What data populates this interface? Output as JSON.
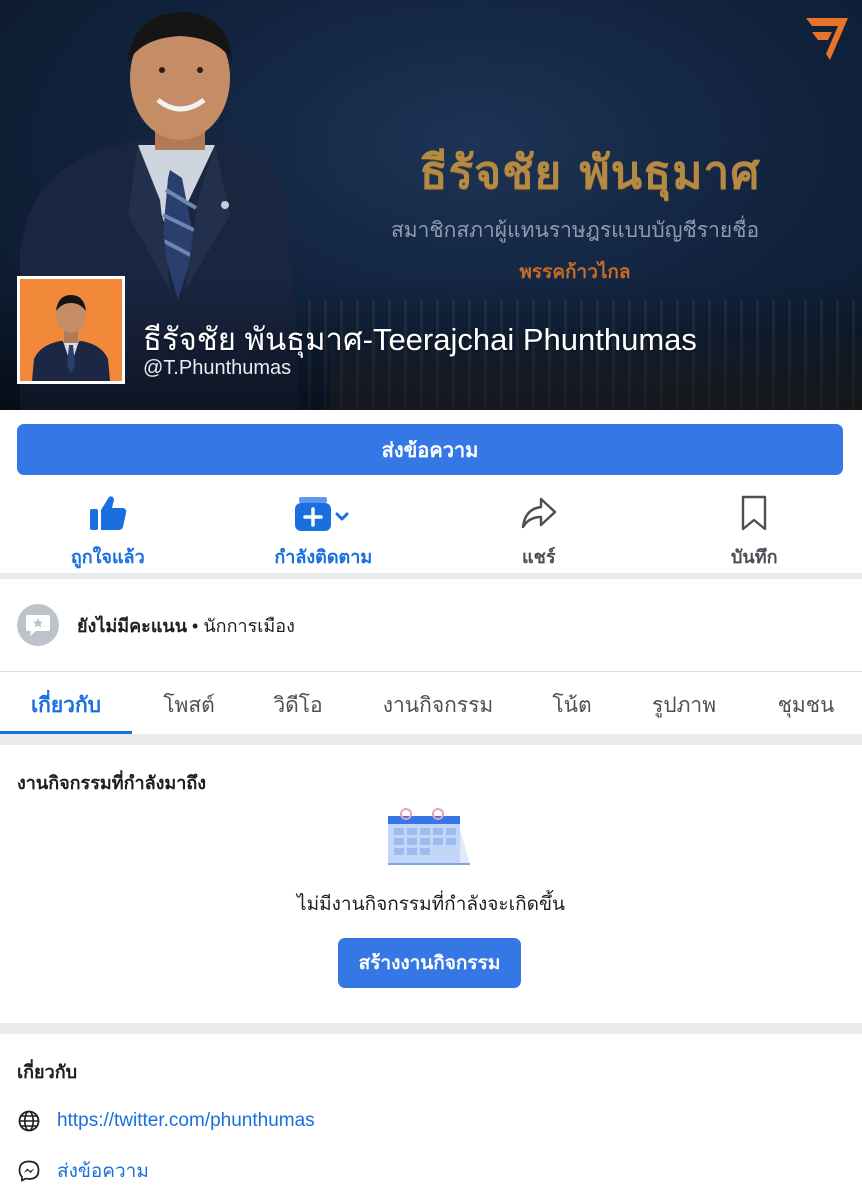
{
  "cover": {
    "name_th": "ธีรัจชัย พันธุมาศ",
    "role": "สมาชิกสภาผู้แทนราษฎรแบบบัญชีรายชื่อ",
    "party": "พรรคก้าวไกล"
  },
  "profile": {
    "name": "ธีรัจชัย พันธุมาศ-Teerajchai Phunthumas",
    "handle": "@T.Phunthumas"
  },
  "message_button": "ส่งข้อความ",
  "actions": [
    {
      "label": "ถูกใจแล้ว",
      "icon": "thumbs-up-icon",
      "active": true
    },
    {
      "label": "กำลังติดตาม",
      "icon": "following-icon",
      "active": true
    },
    {
      "label": "แชร์",
      "icon": "share-icon",
      "active": false
    },
    {
      "label": "บันทึก",
      "icon": "bookmark-icon",
      "active": false
    }
  ],
  "rating": {
    "status": "ยังไม่มีคะแนน",
    "separator": " • ",
    "category": "นักการเมือง"
  },
  "tabs": [
    {
      "label": "เกี่ยวกับ",
      "active": true
    },
    {
      "label": "โพสต์",
      "active": false
    },
    {
      "label": "วิดีโอ",
      "active": false
    },
    {
      "label": "งานกิจกรรม",
      "active": false
    },
    {
      "label": "โน้ต",
      "active": false
    },
    {
      "label": "รูปภาพ",
      "active": false
    },
    {
      "label": "ชุมชน",
      "active": false
    }
  ],
  "events": {
    "title": "งานกิจกรรมที่กำลังมาถึง",
    "empty_text": "ไม่มีงานกิจกรรมที่กำลังจะเกิดขึ้น",
    "create_button": "สร้างงานกิจกรรม"
  },
  "about": {
    "title": "เกี่ยวกับ",
    "website": "https://twitter.com/phunthumas",
    "message_link": "ส่งข้อความ"
  },
  "colors": {
    "accent": "#3578e5",
    "link": "#1a6fe0",
    "party_orange": "#c76a24",
    "cover_gold": "#b48a44"
  }
}
